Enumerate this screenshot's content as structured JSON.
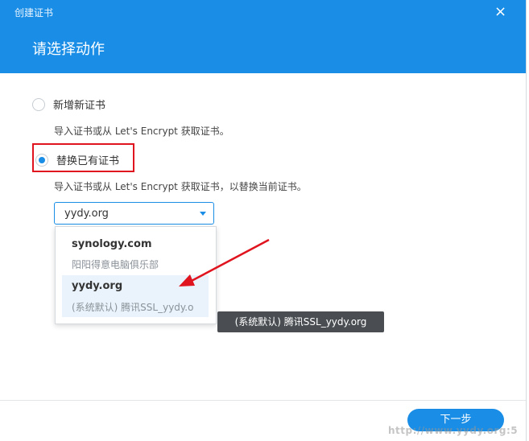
{
  "window": {
    "title": "创建证书",
    "close_icon": "×"
  },
  "header": {
    "title": "请选择动作"
  },
  "options": [
    {
      "label": "新增新证书",
      "description": "导入证书或从 Let's Encrypt 获取证书。",
      "checked": false
    },
    {
      "label": "替换已有证书",
      "description": "导入证书或从 Let's Encrypt 获取证书，以替换当前证书。",
      "checked": true
    }
  ],
  "select": {
    "value": "yydy.org"
  },
  "dropdown": {
    "items": [
      {
        "name": "synology.com",
        "subtitle": "阳阳得意电脑俱乐部"
      },
      {
        "name": "yydy.org",
        "subtitle": "(系统默认) 腾讯SSL_yydy.o"
      }
    ]
  },
  "tooltip": {
    "text": "(系统默认) 腾讯SSL_yydy.org"
  },
  "footer": {
    "next_label": "下一步"
  },
  "watermark": {
    "text": "http://www.yydy.org:5"
  },
  "colors": {
    "accent": "#1a8ee6",
    "highlight": "#e0141e",
    "tooltip_bg": "#4a4e52"
  }
}
